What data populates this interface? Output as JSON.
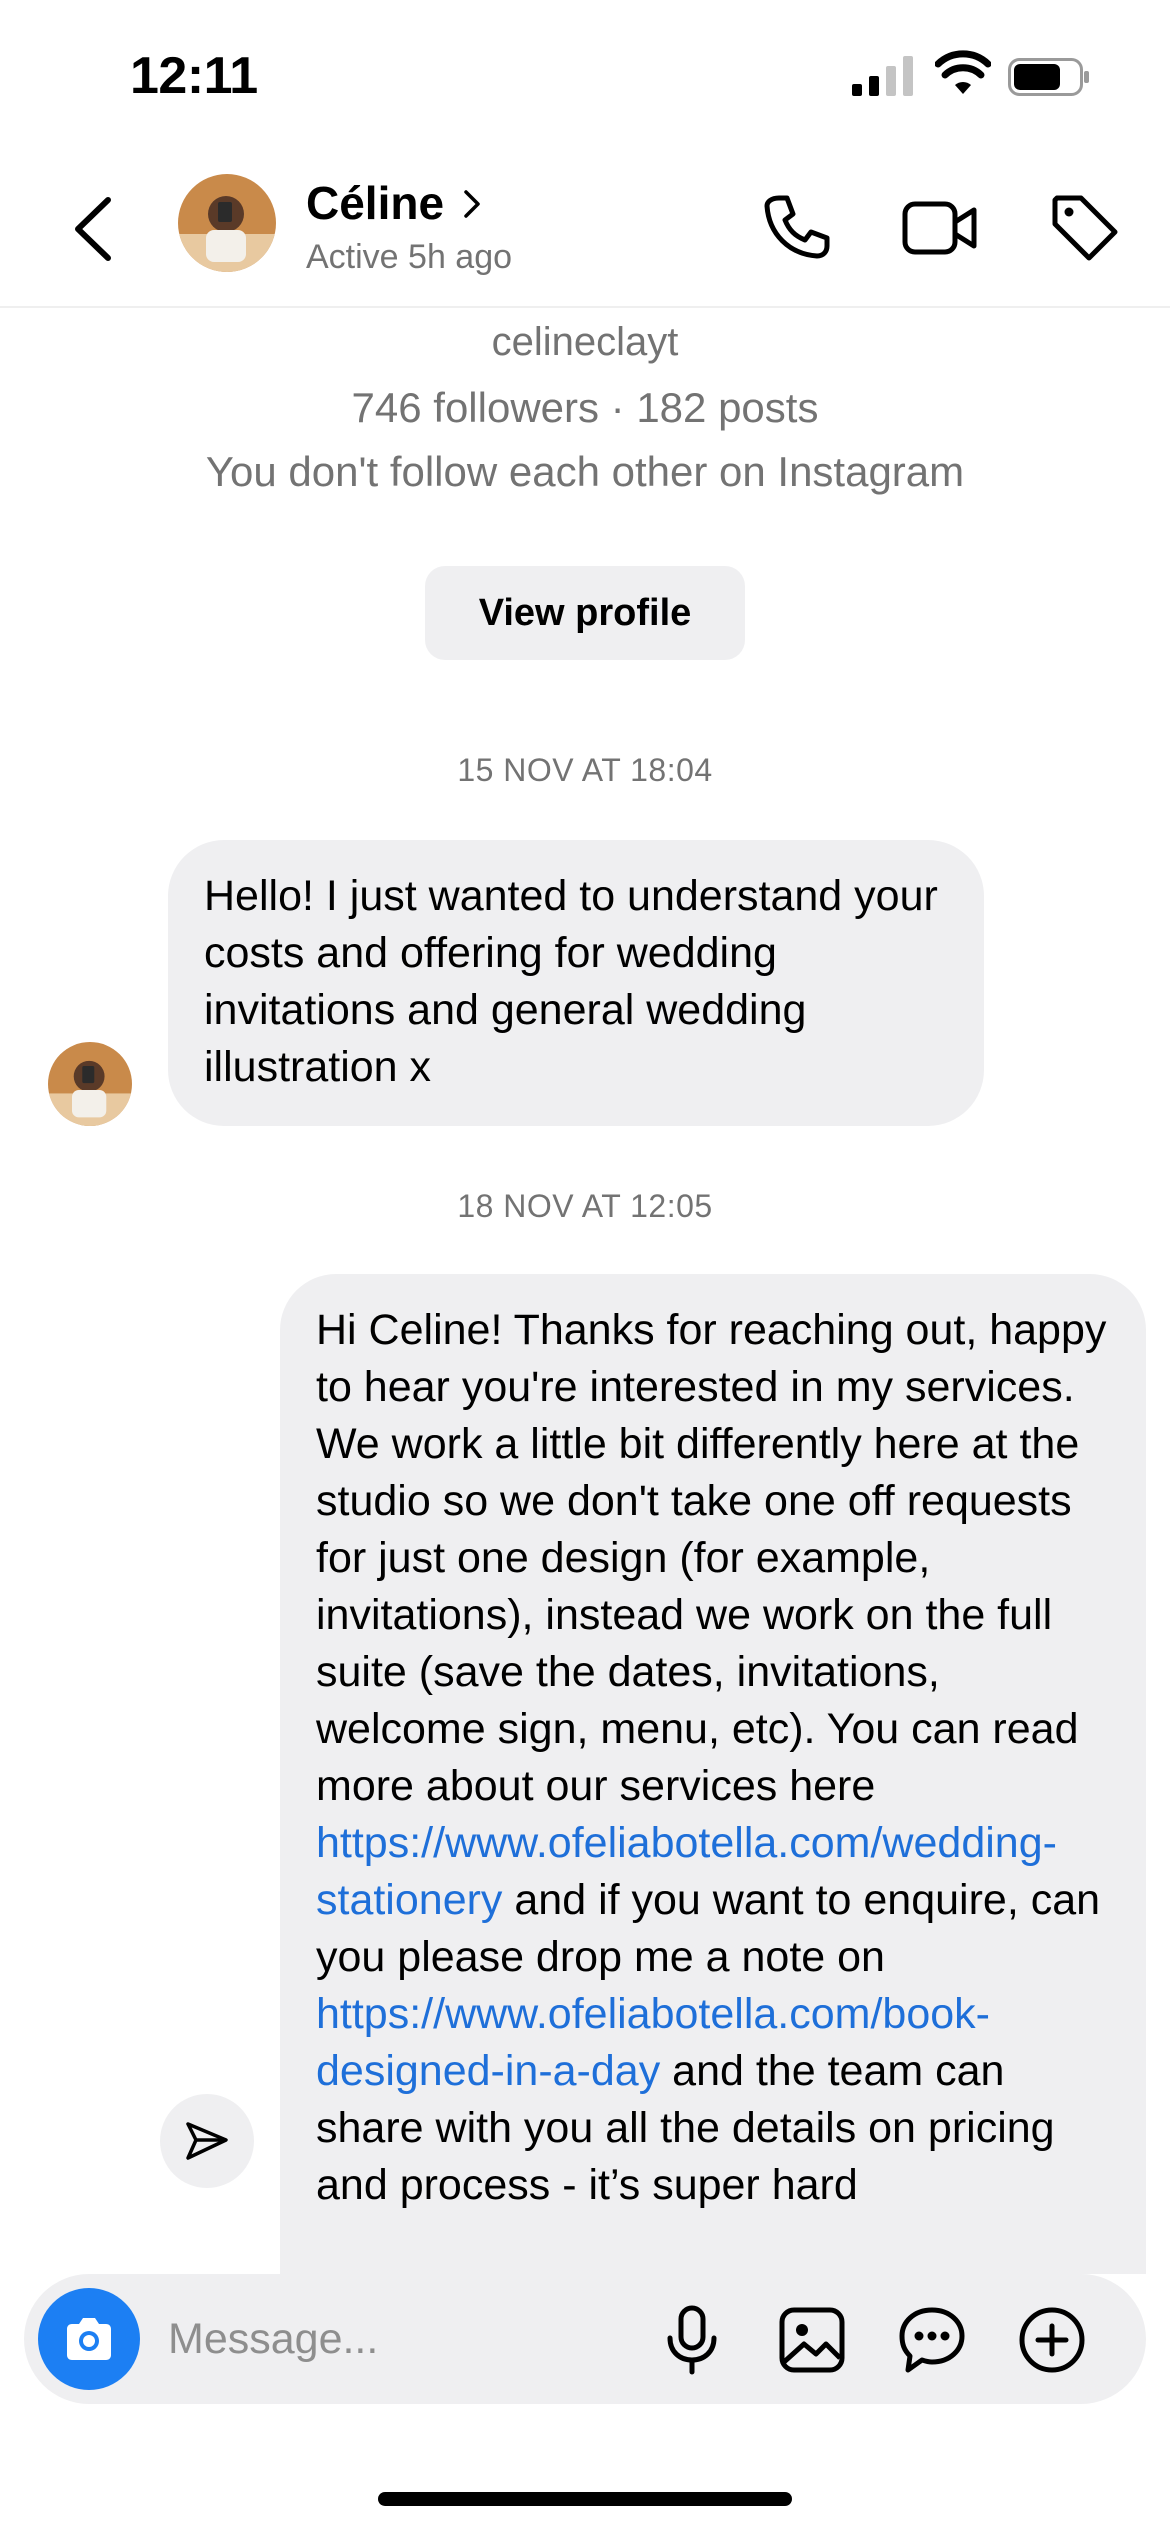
{
  "status_bar": {
    "time": "12:11"
  },
  "header": {
    "name": "Céline",
    "status": "Active 5h ago",
    "icons": [
      "back-icon",
      "chevron-right-icon",
      "phone-icon",
      "video-icon",
      "tag-icon"
    ]
  },
  "profile": {
    "username": "celineclayt",
    "stats": "746 followers · 182 posts",
    "follow_status": "You don't follow each other on Instagram",
    "view_profile_label": "View profile"
  },
  "conversation": {
    "timestamp_1": "15 NOV AT 18:04",
    "message_1": "Hello! I just wanted to understand your costs and offering for wedding invitations and general wedding illustration x",
    "timestamp_2": "18 NOV AT 12:05",
    "message_2": {
      "part_1": "Hi Celine! Thanks for reaching out, happy to hear you're interested in my services. We work a little bit differently here at the studio so we don't take one off requests for just one design (for example, invitations), instead we work on the full suite (save the dates, invitations, welcome sign, menu, etc). You can read more about our services here ",
      "link_1": "https://www.ofeliabotella.com/wedding-stationery",
      "part_2": " and if you want to enquire, can you please drop me a note on ",
      "link_2": "https://www.ofeliabotella.com/book-designed-in-a-day",
      "part_3": " and the team can share with you all the details on pricing and process - it’s super hard"
    }
  },
  "composer": {
    "placeholder": "Message...",
    "icons": [
      "camera-icon",
      "microphone-icon",
      "gallery-icon",
      "sticker-icon",
      "plus-icon"
    ]
  },
  "colors": {
    "accent": "#1c7ff3",
    "link": "#1e6fd9",
    "bubble": "#efeff1",
    "secondary_text": "#737373"
  }
}
